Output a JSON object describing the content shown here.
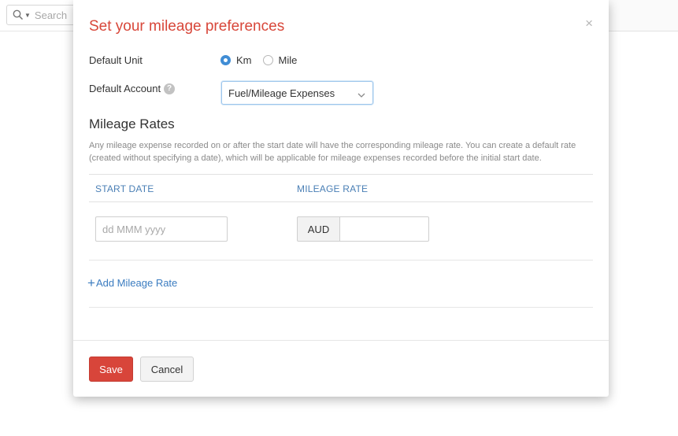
{
  "background": {
    "search_placeholder": "Search"
  },
  "modal": {
    "title": "Set your mileage preferences",
    "close_glyph": "×",
    "default_unit": {
      "label": "Default Unit",
      "options": [
        {
          "label": "Km",
          "checked": true
        },
        {
          "label": "Mile",
          "checked": false
        }
      ]
    },
    "default_account": {
      "label": "Default Account",
      "help_glyph": "?",
      "selected": "Fuel/Mileage Expenses"
    },
    "mileage_rates": {
      "title": "Mileage Rates",
      "help_text": "Any mileage expense recorded on or after the start date will have the corresponding mileage rate. You can create a default rate (created without specifying a date), which will be applicable for mileage expenses recorded before the initial start date.",
      "columns": [
        "START DATE",
        "MILEAGE RATE"
      ],
      "rows": [
        {
          "start_date_placeholder": "dd MMM yyyy",
          "currency": "AUD",
          "rate": ""
        }
      ],
      "add_label": "Add Mileage Rate",
      "add_glyph": "+"
    },
    "footer": {
      "save_label": "Save",
      "cancel_label": "Cancel"
    }
  },
  "colors": {
    "title": "#d8473a",
    "primary_button": "#d8453a",
    "link": "#3b7cc0",
    "radio_checked": "#408dd5"
  },
  "icons": [
    "search-icon",
    "chevron-down-icon",
    "close-icon",
    "help-icon",
    "plus-icon"
  ]
}
